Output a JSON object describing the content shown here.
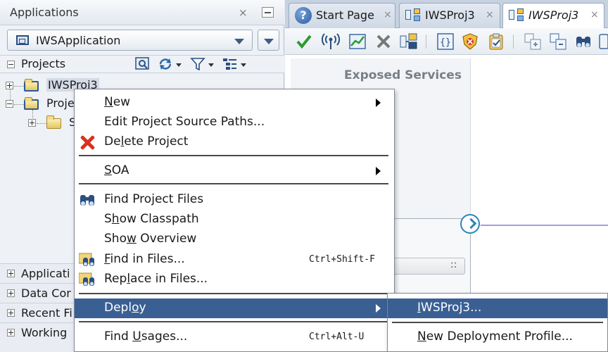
{
  "left_panel": {
    "title": "Applications",
    "close_glyph": "×",
    "app_selector_value": "IWSApplication",
    "projects_label": "Projects",
    "tree": [
      {
        "label": "IWSProj3"
      },
      {
        "label": "Proje"
      },
      {
        "label": "S"
      }
    ],
    "accordions": [
      {
        "label": "Applicati"
      },
      {
        "label": "Data Cor"
      },
      {
        "label": "Recent Fi"
      },
      {
        "label": "Working"
      }
    ]
  },
  "editor": {
    "tabs": [
      {
        "label": "Start Page",
        "icon": "help-icon"
      },
      {
        "label": "IWSProj3",
        "icon": "composite-icon"
      },
      {
        "label": "IWSProj3",
        "icon": "composite-icon",
        "active": true
      }
    ],
    "tab_close_glyph": "×",
    "exposed_services_title": "Exposed Services",
    "composite_inner_text": "::"
  },
  "context_menu": {
    "items": [
      {
        "pre": "",
        "u": "N",
        "post": "ew",
        "submenu": true
      },
      {
        "pre": "Edit Pro",
        "u": "j",
        "post": "ect Source Paths..."
      },
      {
        "pre": "De",
        "u": "l",
        "post": "ete Project",
        "icon": "delete-icon"
      },
      {
        "pre": "",
        "u": "S",
        "post": "OA",
        "submenu": true
      },
      {
        "pre": "Find Pro",
        "u": "j",
        "post": "ect Files",
        "icon": "binoculars-icon"
      },
      {
        "pre": "S",
        "u": "h",
        "post": "ow Classpath"
      },
      {
        "pre": "Sho",
        "u": "w",
        "post": " Overview"
      },
      {
        "pre": "",
        "u": "F",
        "post": "ind in Files...",
        "accel": "Ctrl+Shift-F",
        "icon": "find-in-files-icon"
      },
      {
        "pre": "Rep",
        "u": "l",
        "post": "ace in Files...",
        "icon": "replace-in-files-icon"
      },
      {
        "pre": "Depl",
        "u": "o",
        "post": "y",
        "submenu": true,
        "highlight": true
      },
      {
        "pre": "Find ",
        "u": "U",
        "post": "sages...",
        "accel": "Ctrl+Alt-U"
      }
    ]
  },
  "submenu": {
    "items": [
      {
        "pre": "",
        "u": "I",
        "post": "WSProj3...",
        "highlight": true
      },
      {
        "pre": "",
        "u": "N",
        "post": "ew Deployment Profile..."
      }
    ]
  },
  "colors": {
    "menu_highlight": "#3a5f93",
    "delete_red": "#d8321f",
    "wire": "#2c86b8"
  }
}
